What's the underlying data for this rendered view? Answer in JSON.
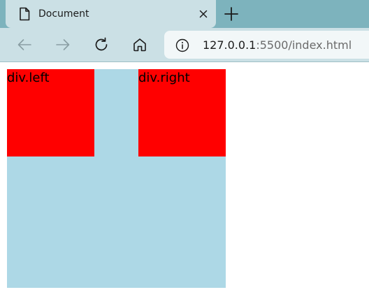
{
  "browser": {
    "tab": {
      "title": "Document",
      "page_icon": "document-icon",
      "close_icon": "close-icon"
    },
    "new_tab_icon": "plus-icon",
    "toolbar": {
      "back_icon": "arrow-left-icon",
      "forward_icon": "arrow-right-icon",
      "reload_icon": "refresh-icon",
      "home_icon": "home-icon",
      "info_icon": "info-circle-icon"
    },
    "address": {
      "host": "127.0.0.1",
      "rest": ":5500/index.html"
    }
  },
  "page": {
    "container_color": "#add8e6",
    "box_color": "#ff0000",
    "left_label": "div.left",
    "right_label": "div.right"
  }
}
